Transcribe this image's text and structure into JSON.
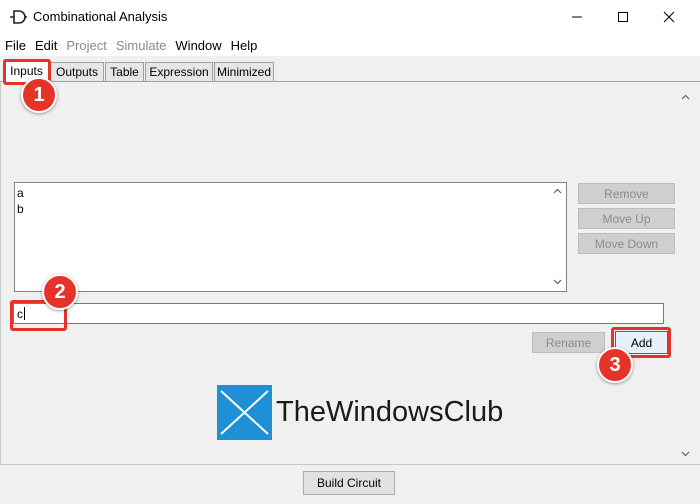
{
  "window": {
    "title": "Combinational Analysis",
    "controls": {
      "minimize": "minimize-icon",
      "maximize": "maximize-icon",
      "close": "close-icon"
    }
  },
  "menu": [
    {
      "label": "File",
      "enabled": true
    },
    {
      "label": "Edit",
      "enabled": true
    },
    {
      "label": "Project",
      "enabled": false
    },
    {
      "label": "Simulate",
      "enabled": false
    },
    {
      "label": "Window",
      "enabled": true
    },
    {
      "label": "Help",
      "enabled": true
    }
  ],
  "tabs": [
    {
      "label": "Inputs",
      "active": true
    },
    {
      "label": "Outputs",
      "active": false
    },
    {
      "label": "Table",
      "active": false
    },
    {
      "label": "Expression",
      "active": false
    },
    {
      "label": "Minimized",
      "active": false
    }
  ],
  "inputs": {
    "variables": [
      "a",
      "b"
    ],
    "remove_label": "Remove",
    "move_up_label": "Move Up",
    "move_down_label": "Move Down",
    "name_field_value": "c",
    "rename_label": "Rename",
    "add_label": "Add"
  },
  "footer": {
    "build_label": "Build Circuit"
  },
  "annotations": {
    "step1": "1",
    "step2": "2",
    "step3": "3",
    "color": "#e5332a"
  },
  "watermark": {
    "text": "TheWindowsClub",
    "color": "#1f8fd6"
  }
}
